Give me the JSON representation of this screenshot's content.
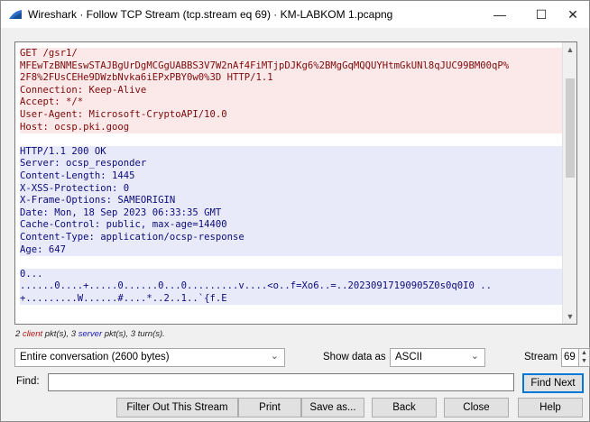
{
  "window": {
    "title": "Wireshark · Follow TCP Stream (tcp.stream eq 69) · KM-LABKOM 1.pcapng",
    "minimize_glyph": "—",
    "maximize_glyph": "☐",
    "close_glyph": "✕",
    "icon": "wireshark-fin-icon",
    "accent_color": "#2b6fc6"
  },
  "stream": {
    "client_color": "#7c0a0a",
    "client_bg": "#fbe9ea",
    "server_color": "#0c0c7a",
    "server_bg": "#e9eaf9",
    "lines": [
      {
        "who": "client",
        "text": "GET /gsr1/"
      },
      {
        "who": "client",
        "text": "MFEwTzBNMEswSTAJBgUrDgMCGgUABBS3V7W2nAf4FiMTjpDJKg6%2BMgGqMQQUYHtmGkUNl8qJUC99BM00qP%"
      },
      {
        "who": "client",
        "text": "2F8%2FUsCEHe9DWzbNvka6iEPxPBY0w0%3D HTTP/1.1"
      },
      {
        "who": "client",
        "text": "Connection: Keep-Alive"
      },
      {
        "who": "client",
        "text": "Accept: */*"
      },
      {
        "who": "client",
        "text": "User-Agent: Microsoft-CryptoAPI/10.0"
      },
      {
        "who": "client",
        "text": "Host: ocsp.pki.goog"
      },
      {
        "who": "blank",
        "text": ""
      },
      {
        "who": "server",
        "text": "HTTP/1.1 200 OK"
      },
      {
        "who": "server",
        "text": "Server: ocsp_responder"
      },
      {
        "who": "server",
        "text": "Content-Length: 1445"
      },
      {
        "who": "server",
        "text": "X-XSS-Protection: 0"
      },
      {
        "who": "server",
        "text": "X-Frame-Options: SAMEORIGIN"
      },
      {
        "who": "server",
        "text": "Date: Mon, 18 Sep 2023 06:33:35 GMT"
      },
      {
        "who": "server",
        "text": "Cache-Control: public, max-age=14400"
      },
      {
        "who": "server",
        "text": "Content-Type: application/ocsp-response"
      },
      {
        "who": "server",
        "text": "Age: 647"
      },
      {
        "who": "blank",
        "text": ""
      },
      {
        "who": "server",
        "text": "0..."
      },
      {
        "who": "server",
        "text": "......0....+.....0......0...0.........v....<o..f=Xo6..=..20230917190905Z0s0q0I0 .."
      },
      {
        "who": "server",
        "text": "+.........W......#....*..2..1..`{f.E"
      }
    ]
  },
  "stats": {
    "prefix": "2 ",
    "client_word": "client",
    "middle": " pkt(s), 3 ",
    "server_word": "server",
    "suffix": " pkt(s), 3 turn(s)."
  },
  "controls": {
    "conversation_value": "Entire conversation (2600 bytes)",
    "show_data_label": "Show data as",
    "show_data_value": "ASCII",
    "stream_label": "Stream",
    "stream_value": "69",
    "find_label": "Find:",
    "find_value": "",
    "find_next_label": "Find Next",
    "chevron": "⌄"
  },
  "buttons": {
    "filter_out": "Filter Out This Stream",
    "print": "Print",
    "save_as": "Save as...",
    "back": "Back",
    "close": "Close",
    "help": "Help"
  }
}
